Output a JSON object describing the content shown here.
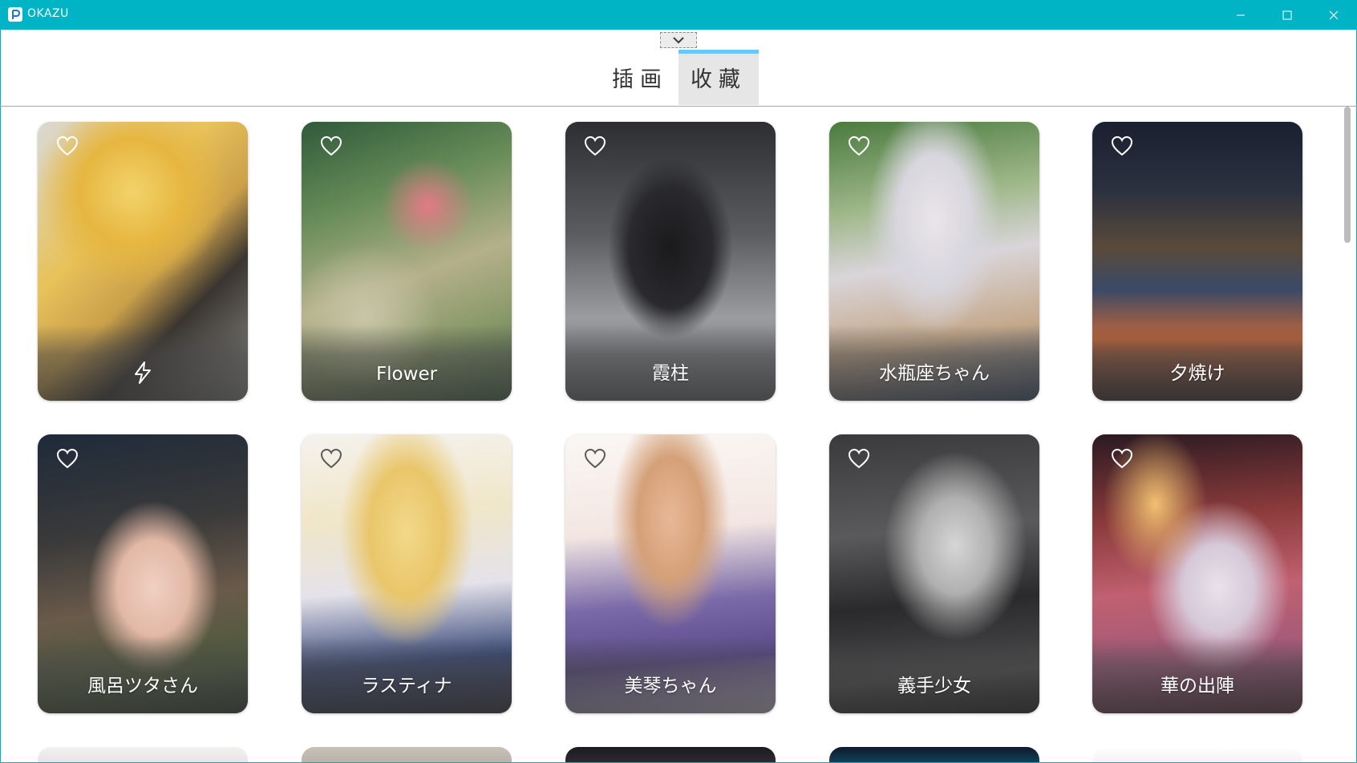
{
  "window": {
    "title": "OKAZU",
    "minimize_label": "minimize",
    "maximize_label": "maximize",
    "close_label": "close"
  },
  "tabs": [
    {
      "label": "插画",
      "active": false
    },
    {
      "label": "收藏",
      "active": true
    }
  ],
  "colors": {
    "titlebar": "#00b4c6",
    "active_tab_bar": "#6ec6f2",
    "active_tab_bg": "#e6e6e6"
  },
  "cards": [
    {
      "caption": "",
      "icon": "lightning-icon",
      "favorited": false
    },
    {
      "caption": "Flower",
      "favorited": false
    },
    {
      "caption": "霞柱",
      "favorited": false
    },
    {
      "caption": "水瓶座ちゃん",
      "favorited": false
    },
    {
      "caption": "夕焼け",
      "favorited": false
    },
    {
      "caption": "風呂ツタさん",
      "favorited": false
    },
    {
      "caption": "ラスティナ",
      "favorited": false
    },
    {
      "caption": "美琴ちゃん",
      "favorited": false
    },
    {
      "caption": "義手少女",
      "favorited": false
    },
    {
      "caption": "華の出陣",
      "favorited": false
    }
  ]
}
